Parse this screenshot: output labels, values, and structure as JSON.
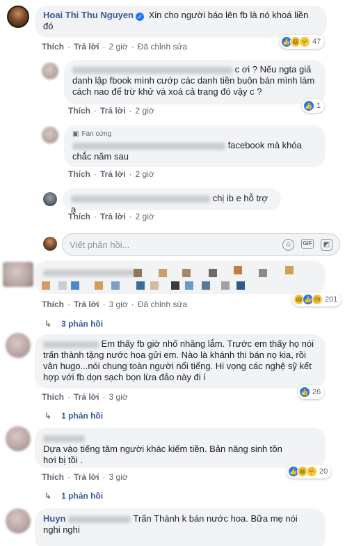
{
  "comment1": {
    "author": "Hoai Thi Thu Nguyen",
    "text_line1": "Xin cho người báo lên fb là nó khoá liền",
    "text_line2": "đó",
    "reaction_count": "47",
    "actions": {
      "like": "Thích",
      "reply": "Trả lời",
      "time": "2 giờ",
      "edited": "Đã chỉnh sửa"
    }
  },
  "reply1": {
    "text_line1": "c ơi ? Nếu ngta giả",
    "text_line2": "danh lập fbook mình cướp các danh tiền buôn bán mình làm",
    "text_line3": "cách nao để trừ khử và xoá cả trang đó vậy c ?",
    "reaction_count": "1",
    "actions": {
      "like": "Thích",
      "reply": "Trả lời",
      "time": "2 giờ"
    }
  },
  "reply2": {
    "badge": "Fan cứng",
    "text_line1": "facebook mà khóa",
    "text_line2": "chắc năm sau",
    "actions": {
      "like": "Thích",
      "reply": "Trả lời",
      "time": "2 giờ"
    }
  },
  "reply3": {
    "text_line1": "chị ib e hỗ trợ ạ",
    "actions": {
      "like": "Thích",
      "reply": "Trả lời",
      "time": "2 giờ"
    }
  },
  "reply_input": {
    "placeholder": "Viết phản hồi..."
  },
  "comment2": {
    "reaction_count": "201",
    "actions": {
      "like": "Thích",
      "reply": "Trả lời",
      "time": "3 giờ",
      "edited": "Đã chỉnh sửa"
    },
    "replies": "3 phản hồi"
  },
  "comment3": {
    "text_line1": "Em thấy fb giờ nhố nhăng lắm. Trước em thấy họ nói",
    "text_line2": "trấn thành tặng nước hoa gửi em. Nào là khánh thi bán nọ kia, rồi",
    "text_line3": "vân hugo...nói chung toàn người nổi tiếng. Hi vọng các nghệ sỹ kết",
    "text_line4": "hợp với fb dọn sạch bọn lừa đảo này đi í",
    "reaction_count": "26",
    "actions": {
      "like": "Thích",
      "reply": "Trả lời",
      "time": "3 giờ"
    },
    "replies": "1 phản hồi"
  },
  "comment4": {
    "text_line1": "Dựa vào tiếng tăm người khác kiếm tiền. Bản năng sinh tồn",
    "text_line2": "hơi bị tồi .",
    "reaction_count": "20",
    "actions": {
      "like": "Thích",
      "reply": "Trả lời",
      "time": "3 giờ"
    },
    "replies": "1 phản hồi"
  },
  "comment5": {
    "name_fragment": "Huyn",
    "text_line1": "Trấn Thành k bán nước hoa. Bữa mẹ nói",
    "text_line2": "nghi nghi"
  },
  "colors": {
    "link": "#385898",
    "bubble": "#f2f3f5",
    "like_blue": "#2078f4",
    "meta": "#606770"
  },
  "icons": [
    "verified-badge-icon",
    "emoji-icon",
    "gif-icon",
    "sticker-icon",
    "reply-arrow-icon",
    "like-reaction-icon",
    "haha-reaction-icon",
    "care-reaction-icon",
    "sad-reaction-icon"
  ]
}
